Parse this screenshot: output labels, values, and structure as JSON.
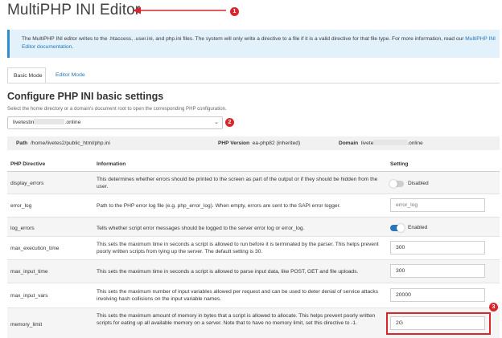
{
  "page_title": "MultiPHP INI Editor",
  "callouts": [
    "1",
    "2",
    "3"
  ],
  "info": {
    "text": "The MultiPHP INI editor writes to the .htaccess, .user.ini, and php.ini files. The system will only write a directive to a file if it is a valid directive for that file type. For more information, read our ",
    "link": "MultiPHP INI Editor documentation",
    "end": "."
  },
  "tabs": [
    {
      "label": "Basic Mode",
      "active": true
    },
    {
      "label": "Editor Mode",
      "active": false
    }
  ],
  "section": {
    "heading": "Configure PHP INI basic settings",
    "subtext": "Select the home directory or a domain's document root to open the corresponding PHP configuration."
  },
  "domain_select": {
    "prefix": "livetestin",
    "suffix": ".online"
  },
  "path_bar": {
    "path_label": "Path",
    "path_value": "/home/livetes2/public_html/php.ini",
    "version_label": "PHP Version",
    "version_value": "ea-php82 (inherited)",
    "domain_label": "Domain",
    "domain_prefix": "livete",
    "domain_suffix": ".online"
  },
  "table": {
    "headers": {
      "directive": "PHP Directive",
      "info": "Information",
      "setting": "Setting"
    },
    "rows": [
      {
        "name": "display_errors",
        "info": "This determines whether errors should be printed to the screen as part of the output or if they should be hidden from the user.",
        "setting_type": "toggle",
        "enabled": false,
        "setting_label": "Disabled"
      },
      {
        "name": "error_log",
        "info": "Path to the PHP error log file (e.g. php_error_log). When empty, errors are sent to the SAPI error logger.",
        "setting_type": "input",
        "value": "",
        "placeholder": "error_log"
      },
      {
        "name": "log_errors",
        "info": "Tells whether script error messages should be logged to the server error log or error_log.",
        "setting_type": "toggle",
        "enabled": true,
        "setting_label": "Enabled"
      },
      {
        "name": "max_execution_time",
        "info": "This sets the maximum time in seconds a script is allowed to run before it is terminated by the parser. This helps prevent poorly written scripts from tying up the server. The default setting is 30.",
        "setting_type": "input",
        "value": "300"
      },
      {
        "name": "max_input_time",
        "info": "This sets the maximum time in seconds a script is allowed to parse input data, like POST, GET and file uploads.",
        "setting_type": "input",
        "value": "300"
      },
      {
        "name": "max_input_vars",
        "info": "This sets the maximum number of input variables allowed per request and can be used to deter denial of service attacks involving hash collisions on the input variable names.",
        "setting_type": "input",
        "value": "20000"
      },
      {
        "name": "memory_limit",
        "info": "This sets the maximum amount of memory in bytes that a script is allowed to allocate. This helps prevent poorly written scripts for eating up all available memory on a server. Note that to have no memory limit, set this directive to -1.",
        "setting_type": "input",
        "value": "2G"
      }
    ]
  },
  "colors": {
    "accent": "#2275b9",
    "callout": "#d9262a",
    "toggle_on": "#2a76bd",
    "toggle_off": "#cfcfcf"
  }
}
